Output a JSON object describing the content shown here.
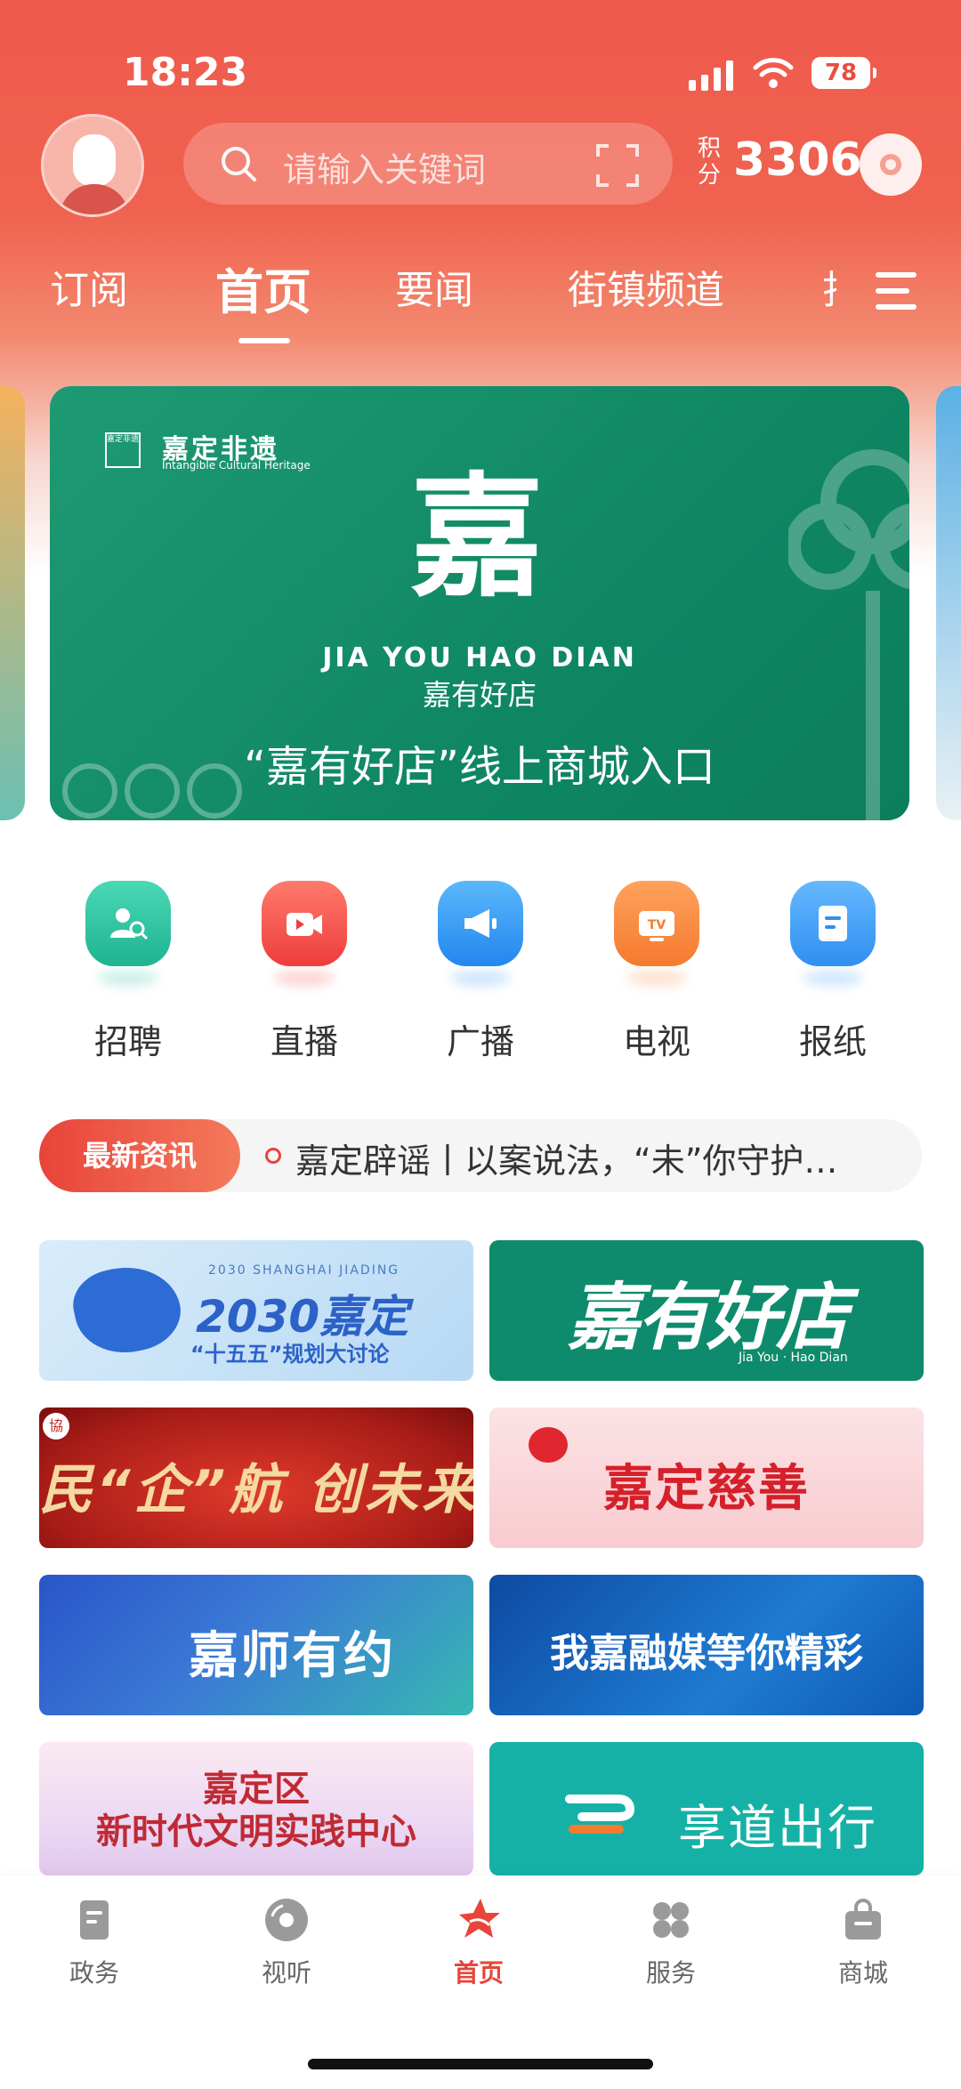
{
  "status_bar": {
    "time": "18:23",
    "battery": "78"
  },
  "header": {
    "search_placeholder": "请输入关键词",
    "points_label": "积分",
    "points_value": "3306"
  },
  "tabs": [
    {
      "label": "订阅"
    },
    {
      "label": "首页"
    },
    {
      "label": "要闻"
    },
    {
      "label": "街镇频道"
    },
    {
      "label": "打"
    }
  ],
  "active_tab": "首页",
  "banner": {
    "brand": "嘉定非遗",
    "brand_sub": "Intangible Cultural Heritage",
    "seal": "嘉定非遗",
    "big_char": "嘉",
    "english": "JIA YOU HAO DIAN",
    "chinese": "嘉有好店",
    "caption": "“嘉有好店”线上商城入口"
  },
  "quick_actions": [
    {
      "label": "招聘",
      "icon": "recruit-icon",
      "color": "#27c4a2"
    },
    {
      "label": "直播",
      "icon": "live-video-icon",
      "color": "#f24f4f"
    },
    {
      "label": "广播",
      "icon": "megaphone-icon",
      "color": "#2f9df0"
    },
    {
      "label": "电视",
      "icon": "tv-icon",
      "color": "#f58a3c"
    },
    {
      "label": "报纸",
      "icon": "newspaper-icon",
      "color": "#3b9df2"
    }
  ],
  "news": {
    "tag": "最新资讯",
    "headline": "嘉定辟谣丨以案说法，“未”你守护…"
  },
  "cards": {
    "c1": {
      "top": "2030 SHANGHAI JIADING",
      "main": "2030嘉定",
      "sub": "“十五五”规划大讨论"
    },
    "c2": {
      "main": "嘉有好店",
      "sub": "Jia You · Hao Dian"
    },
    "c3": {
      "logo": "協",
      "main": "民“企”航 创未来"
    },
    "c4": {
      "main": "嘉定慈善"
    },
    "c5": {
      "main": "嘉师有约"
    },
    "c6": {
      "main": "我嘉融媒等你精彩"
    },
    "c7": {
      "line1": "嘉定区",
      "line2": "新时代文明实践中心"
    },
    "c8": {
      "main": "享道出行"
    }
  },
  "bottom_nav": [
    {
      "label": "政务",
      "icon": "government-icon"
    },
    {
      "label": "视听",
      "icon": "disc-icon"
    },
    {
      "label": "首页",
      "icon": "home-star-icon"
    },
    {
      "label": "服务",
      "icon": "grid-icon"
    },
    {
      "label": "商城",
      "icon": "shopping-bag-icon"
    }
  ],
  "colors": {
    "accent": "#e8443a",
    "banner_green": "#0f8763"
  }
}
